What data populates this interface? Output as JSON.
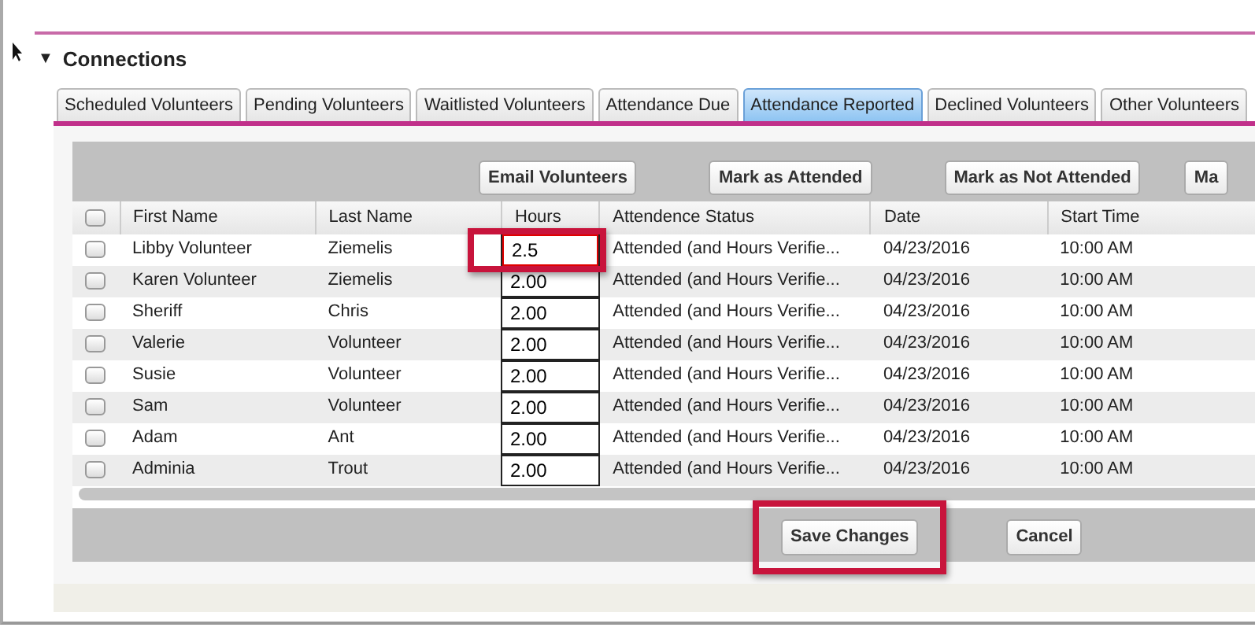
{
  "section": {
    "toggle": "▼",
    "title": "Connections",
    "expanded": true
  },
  "tabs": [
    {
      "label": "Scheduled Volunteers",
      "selected": false
    },
    {
      "label": "Pending Volunteers",
      "selected": false
    },
    {
      "label": "Waitlisted Volunteers",
      "selected": false
    },
    {
      "label": "Attendance Due",
      "selected": false
    },
    {
      "label": "Attendance Reported",
      "selected": true
    },
    {
      "label": "Declined Volunteers",
      "selected": false
    },
    {
      "label": "Other Volunteers",
      "selected": false
    }
  ],
  "toolbar": {
    "buttons": [
      "Email Volunteers",
      "Mark as Attended",
      "Mark as Not Attended",
      "Ma"
    ]
  },
  "table": {
    "select_all_checked": false,
    "columns": [
      "First Name",
      "Last Name",
      "Hours",
      "Attendence Status",
      "Date",
      "Start Time"
    ],
    "rows": [
      {
        "checked": false,
        "first_name": "Libby Volunteer",
        "last_name": "Ziemelis",
        "hours": "2.5",
        "edited": true,
        "highlighted": true,
        "status": "Attended (and Hours Verifie...",
        "date": "04/23/2016",
        "start_time": "10:00 AM"
      },
      {
        "checked": false,
        "first_name": "Karen Volunteer",
        "last_name": "Ziemelis",
        "hours": "2.00",
        "edited": false,
        "highlighted": false,
        "status": "Attended (and Hours Verifie...",
        "date": "04/23/2016",
        "start_time": "10:00 AM"
      },
      {
        "checked": false,
        "first_name": "Sheriff",
        "last_name": "Chris",
        "hours": "2.00",
        "edited": false,
        "highlighted": false,
        "status": "Attended (and Hours Verifie...",
        "date": "04/23/2016",
        "start_time": "10:00 AM"
      },
      {
        "checked": false,
        "first_name": "Valerie",
        "last_name": "Volunteer",
        "hours": "2.00",
        "edited": false,
        "highlighted": false,
        "status": "Attended (and Hours Verifie...",
        "date": "04/23/2016",
        "start_time": "10:00 AM"
      },
      {
        "checked": false,
        "first_name": "Susie",
        "last_name": "Volunteer",
        "hours": "2.00",
        "edited": false,
        "highlighted": false,
        "status": "Attended (and Hours Verifie...",
        "date": "04/23/2016",
        "start_time": "10:00 AM"
      },
      {
        "checked": false,
        "first_name": "Sam",
        "last_name": "Volunteer",
        "hours": "2.00",
        "edited": false,
        "highlighted": false,
        "status": "Attended (and Hours Verifie...",
        "date": "04/23/2016",
        "start_time": "10:00 AM"
      },
      {
        "checked": false,
        "first_name": "Adam",
        "last_name": "Ant",
        "hours": "2.00",
        "edited": false,
        "highlighted": false,
        "status": "Attended (and Hours Verifie...",
        "date": "04/23/2016",
        "start_time": "10:00 AM"
      },
      {
        "checked": false,
        "first_name": "Adminia",
        "last_name": "Trout",
        "hours": "2.00",
        "edited": false,
        "highlighted": false,
        "status": "Attended (and Hours Verifie...",
        "date": "04/23/2016",
        "start_time": "10:00 AM"
      }
    ]
  },
  "footer": {
    "buttons": [
      {
        "label": "Save Changes",
        "highlighted": true
      },
      {
        "label": "Cancel",
        "highlighted": false
      }
    ]
  }
}
